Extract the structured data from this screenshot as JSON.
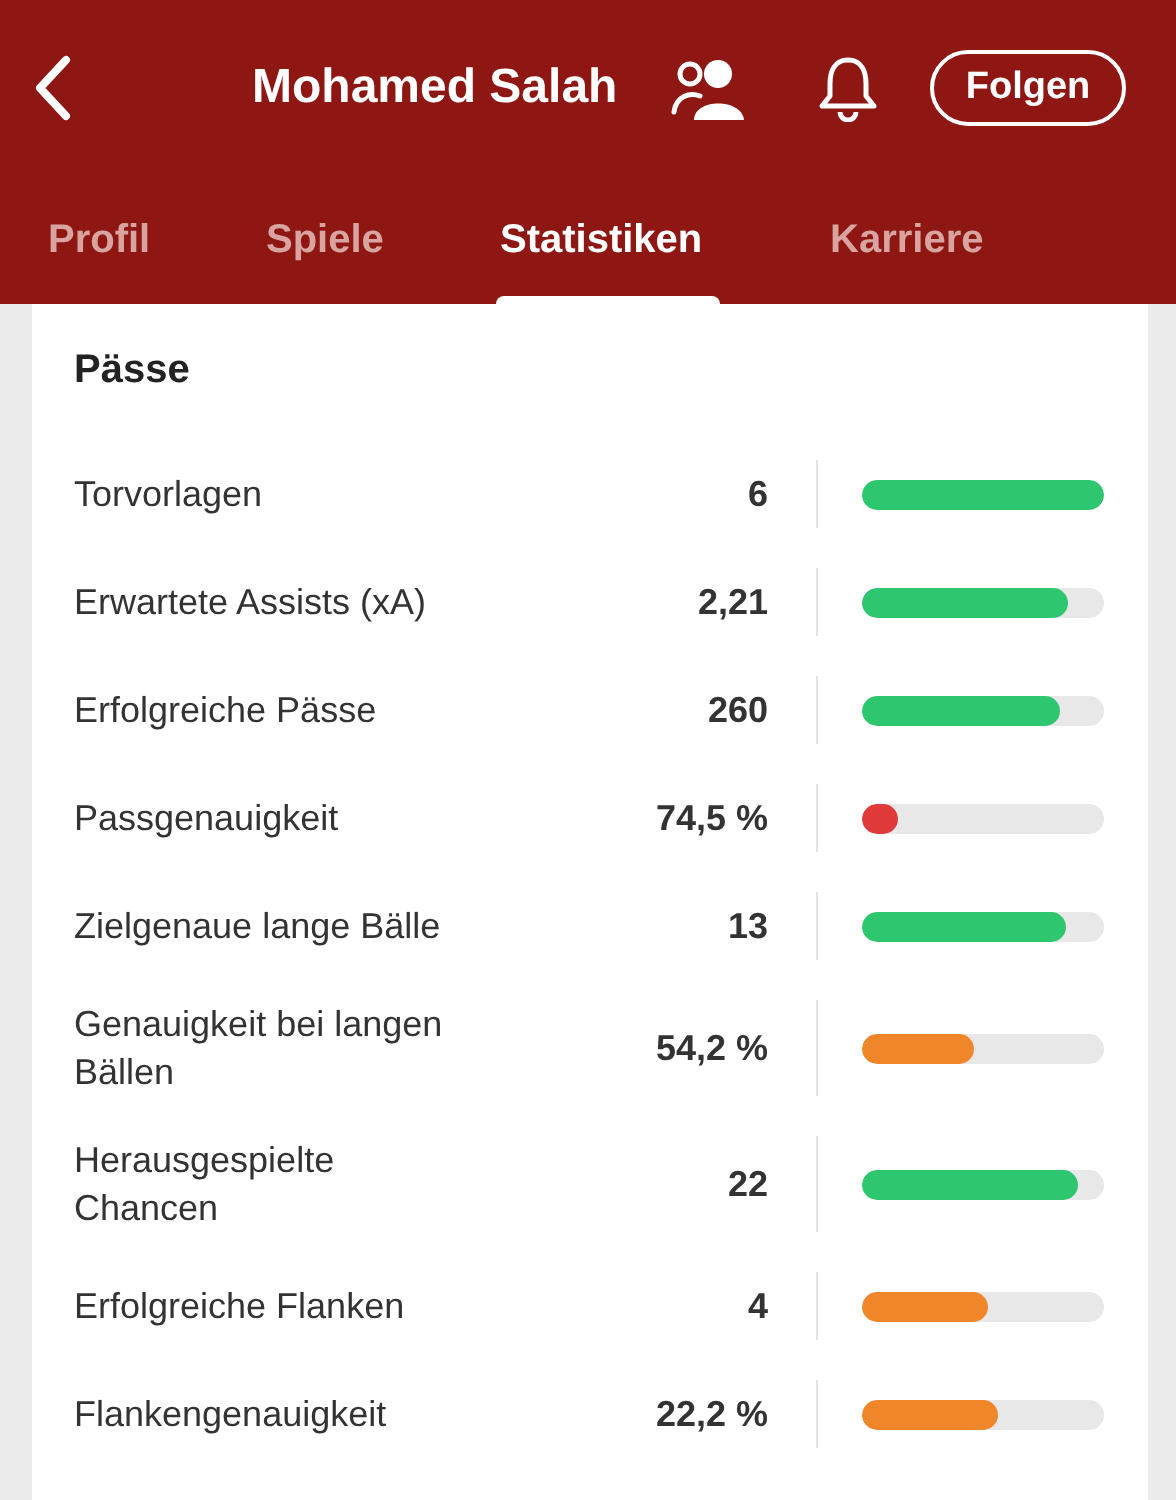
{
  "header": {
    "title": "Mohamed Salah",
    "follow_button": "Folgen"
  },
  "tabs": [
    {
      "label": "Profil",
      "selected": false
    },
    {
      "label": "Spiele",
      "selected": false
    },
    {
      "label": "Statistiken",
      "selected": true
    },
    {
      "label": "Karriere",
      "selected": false
    }
  ],
  "section": {
    "title": "Pässe",
    "rows": [
      {
        "label": "Torvorlagen",
        "value": "6",
        "level": 1.0,
        "color": "#2ec66e"
      },
      {
        "label": "Erwartete Assists (xA)",
        "value": "2,21",
        "level": 0.85,
        "color": "#2ec66e"
      },
      {
        "label": "Erfolgreiche Pässe",
        "value": "260",
        "level": 0.82,
        "color": "#2ec66e"
      },
      {
        "label": "Passgenauigkeit",
        "value": "74,5 %",
        "level": 0.15,
        "color": "#e03a3a"
      },
      {
        "label": "Zielgenaue lange Bälle",
        "value": "13",
        "level": 0.84,
        "color": "#2ec66e"
      },
      {
        "label": "Genauigkeit bei langen Bällen",
        "value": "54,2 %",
        "level": 0.46,
        "color": "#f0862a"
      },
      {
        "label": "Herausgespielte Chancen",
        "value": "22",
        "level": 0.89,
        "color": "#2ec66e"
      },
      {
        "label": "Erfolgreiche Flanken",
        "value": "4",
        "level": 0.52,
        "color": "#f0862a"
      },
      {
        "label": "Flankengenauigkeit",
        "value": "22,2 %",
        "level": 0.56,
        "color": "#f0862a"
      }
    ]
  }
}
